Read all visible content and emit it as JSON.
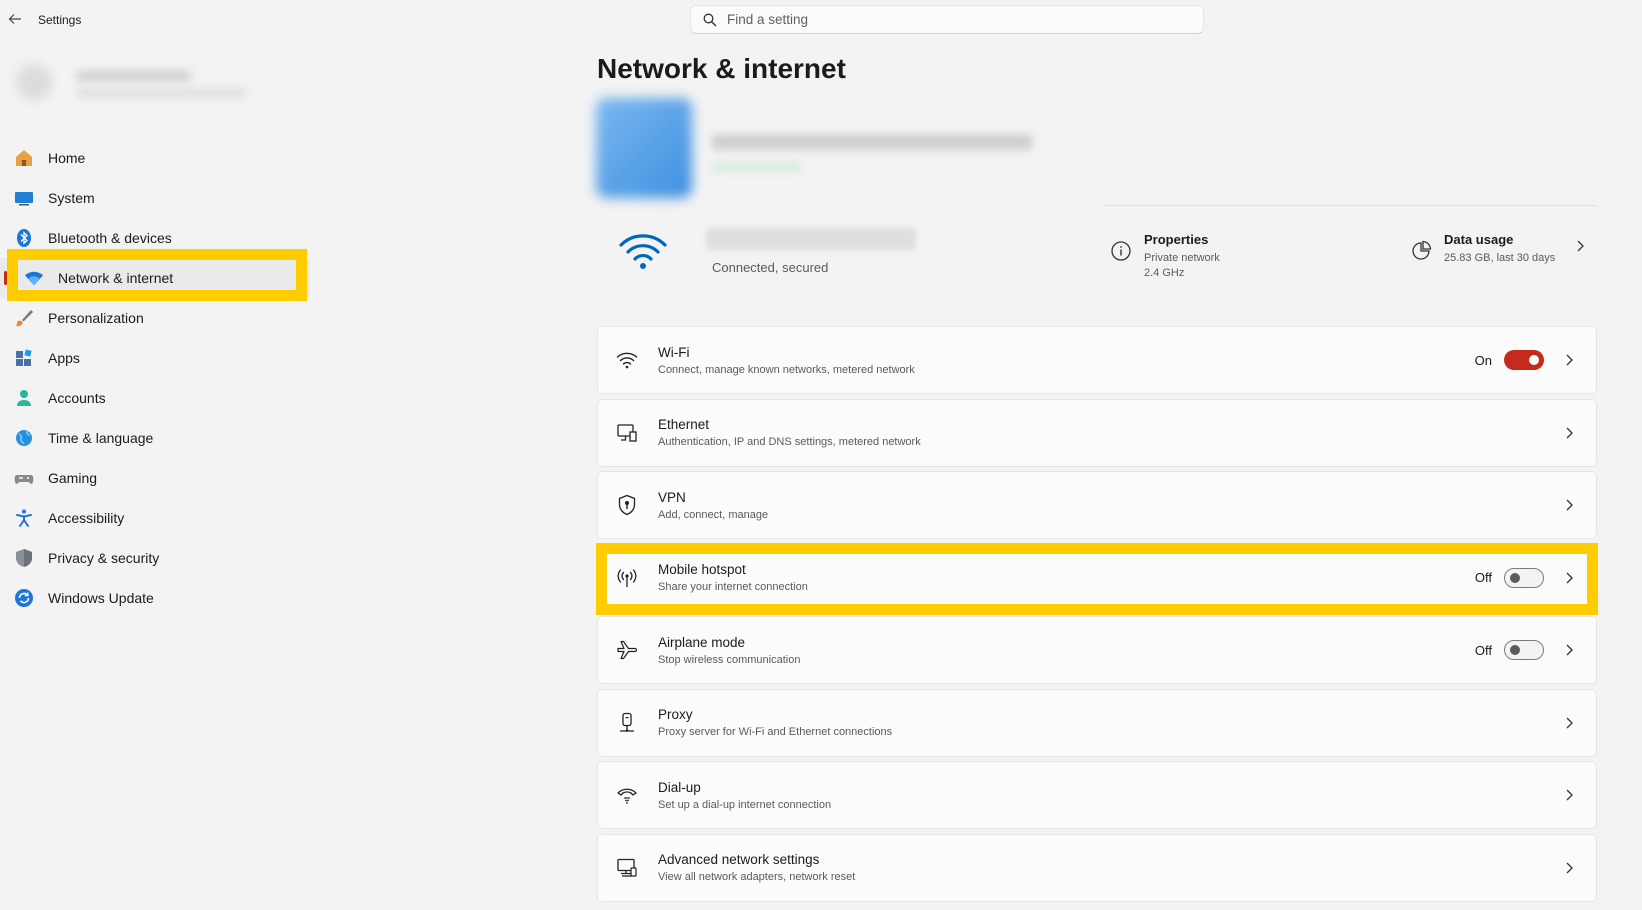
{
  "app": {
    "title": "Settings"
  },
  "search": {
    "placeholder": "Find a setting"
  },
  "sidebar": {
    "items": [
      {
        "label": "Home",
        "icon": "home-icon"
      },
      {
        "label": "System",
        "icon": "system-icon"
      },
      {
        "label": "Bluetooth & devices",
        "icon": "bluetooth-icon"
      },
      {
        "label": "Network & internet",
        "icon": "wifi-icon",
        "selected": true
      },
      {
        "label": "Personalization",
        "icon": "brush-icon"
      },
      {
        "label": "Apps",
        "icon": "apps-icon"
      },
      {
        "label": "Accounts",
        "icon": "person-icon"
      },
      {
        "label": "Time & language",
        "icon": "globe-icon"
      },
      {
        "label": "Gaming",
        "icon": "gamepad-icon"
      },
      {
        "label": "Accessibility",
        "icon": "accessibility-icon"
      },
      {
        "label": "Privacy & security",
        "icon": "shield-icon"
      },
      {
        "label": "Windows Update",
        "icon": "update-icon"
      }
    ]
  },
  "main": {
    "title": "Network & internet",
    "connection": {
      "status": "Connected, secured"
    },
    "properties": {
      "title": "Properties",
      "line1": "Private network",
      "line2": "2.4 GHz"
    },
    "data_usage": {
      "title": "Data usage",
      "detail": "25.83 GB, last 30 days"
    },
    "cards": [
      {
        "title": "Wi-Fi",
        "subtitle": "Connect, manage known networks, metered network",
        "state": "On",
        "icon": "wifi-icon"
      },
      {
        "title": "Ethernet",
        "subtitle": "Authentication, IP and DNS settings, metered network",
        "icon": "ethernet-icon"
      },
      {
        "title": "VPN",
        "subtitle": "Add, connect, manage",
        "icon": "vpn-shield-icon"
      },
      {
        "title": "Mobile hotspot",
        "subtitle": "Share your internet connection",
        "state": "Off",
        "icon": "hotspot-icon"
      },
      {
        "title": "Airplane mode",
        "subtitle": "Stop wireless communication",
        "state": "Off",
        "icon": "airplane-icon"
      },
      {
        "title": "Proxy",
        "subtitle": "Proxy server for Wi-Fi and Ethernet connections",
        "icon": "proxy-icon"
      },
      {
        "title": "Dial-up",
        "subtitle": "Set up a dial-up internet connection",
        "icon": "dialup-icon"
      },
      {
        "title": "Advanced network settings",
        "subtitle": "View all network adapters, network reset",
        "icon": "advanced-network-icon"
      }
    ]
  },
  "colors": {
    "accent": "#c42b1c",
    "highlight": "#ffcc00",
    "wifi_blue": "#0067c0"
  }
}
